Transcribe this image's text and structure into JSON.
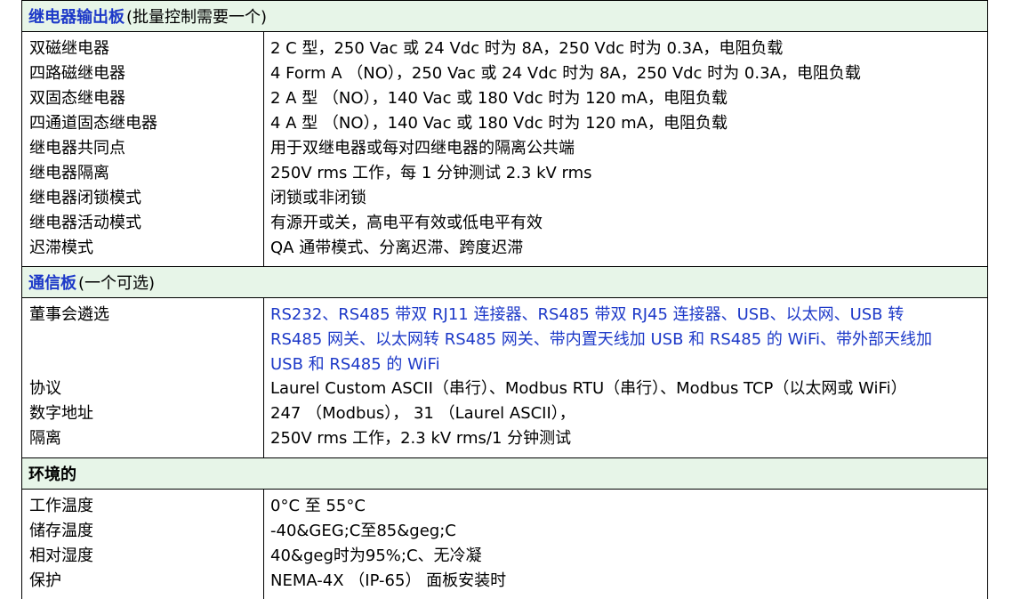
{
  "sections": [
    {
      "title": "继电器输出板",
      "subtitle": "(批量控制需要一个)",
      "rows": [
        {
          "label": "双磁继电器",
          "value": "2 C 型，250 Vac 或 24 Vdc 时为 8A，250 Vdc 时为 0.3A，电阻负载"
        },
        {
          "label": "四路磁继电器",
          "value": "4 Form A （NO），250 Vac 或 24 Vdc 时为 8A，250 Vdc 时为 0.3A，电阻负载"
        },
        {
          "label": "双固态继电器",
          "value": "2 A 型 （NO），140 Vac 或 180 Vdc 时为 120 mA，电阻负载"
        },
        {
          "label": "四通道固态继电器",
          "value": "4 A 型 （NO），140 Vac 或 180 Vdc 时为 120 mA，电阻负载"
        },
        {
          "label": "继电器共同点",
          "value": "用于双继电器或每对四继电器的隔离公共端"
        },
        {
          "label": "继电器隔离",
          "value": "250V rms 工作，每 1 分钟测试 2.3 kV rms"
        },
        {
          "label": "继电器闭锁模式",
          "value": "闭锁或非闭锁"
        },
        {
          "label": "继电器活动模式",
          "value": "有源开或关，高电平有效或低电平有效"
        },
        {
          "label": "迟滞模式",
          "value": "QA 通带模式、分离迟滞、跨度迟滞"
        }
      ]
    },
    {
      "title": "通信板",
      "subtitle": "(一个可选)",
      "rows": [
        {
          "label": "董事会遴选",
          "value_lines": [
            "RS232、RS485 带双 RJ11 连接器、RS485 带双 RJ45 连接器、USB、以太网、USB 转",
            "RS485 网关、以太网转 RS485 网关、带内置天线加 USB 和 RS485 的 WiFi、带外部天线加",
            "USB 和 RS485 的 WiFi"
          ]
        },
        {
          "label": "协议",
          "value": "Laurel Custom ASCII（串行）、Modbus RTU（串行）、Modbus TCP（以太网或 WiFi）"
        },
        {
          "label": "数字地址",
          "value": "247 （Modbus）， 31 （Laurel ASCII），"
        },
        {
          "label": "隔离",
          "value": "250V rms 工作，2.3 kV rms/1 分钟测试"
        }
      ]
    },
    {
      "title": "环境的",
      "subtitle": "",
      "rows": [
        {
          "label": "工作温度",
          "value": "0°C 至 55°C"
        },
        {
          "label": "储存温度",
          "value": "-40&GEG;C至85&geg;C"
        },
        {
          "label": "相对湿度",
          "value": "40&geg时为95%;C、无冷凝"
        },
        {
          "label": "保护",
          "value": "NEMA-4X （IP-65） 面板安装时"
        }
      ]
    }
  ],
  "colors": {
    "accent_blue": "#1d39c8",
    "header_bg": "#e7f5e8"
  }
}
